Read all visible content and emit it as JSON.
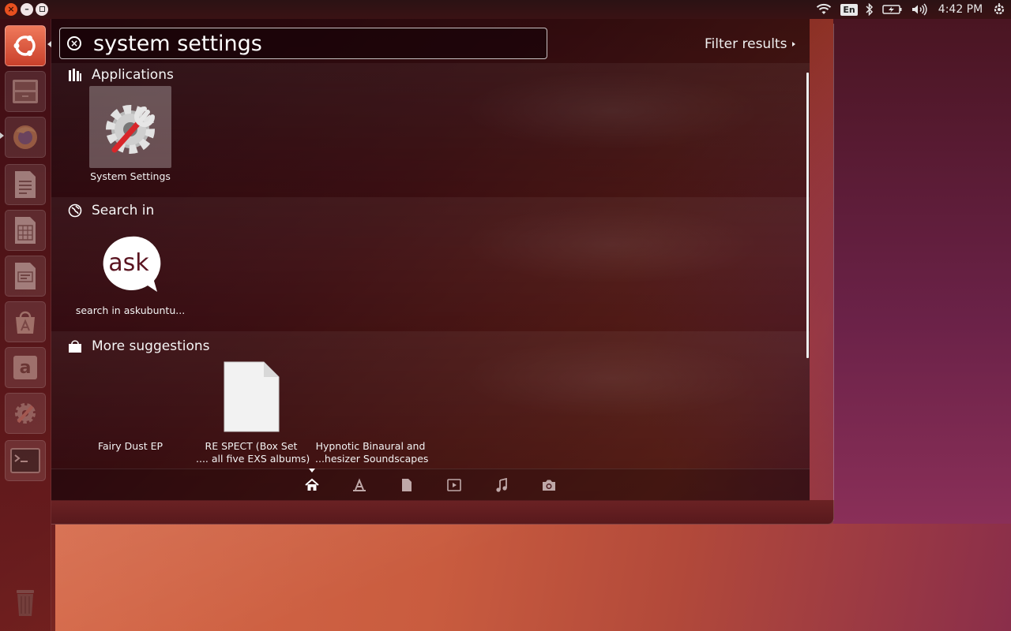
{
  "top_panel": {
    "keyboard_layout": "En",
    "clock": "4:42 PM"
  },
  "launcher": {
    "items": [
      {
        "name": "Dash home"
      },
      {
        "name": "Files"
      },
      {
        "name": "Firefox Web Browser"
      },
      {
        "name": "LibreOffice Writer"
      },
      {
        "name": "LibreOffice Calc"
      },
      {
        "name": "LibreOffice Impress"
      },
      {
        "name": "Ubuntu Software Center"
      },
      {
        "name": "Amazon"
      },
      {
        "name": "System Settings"
      },
      {
        "name": "Terminal"
      },
      {
        "name": "Trash"
      }
    ]
  },
  "search": {
    "query": "system settings"
  },
  "filter": {
    "label": "Filter results"
  },
  "sections": {
    "applications": {
      "title": "Applications",
      "items": [
        {
          "label": "System Settings"
        }
      ]
    },
    "search_in": {
      "title": "Search in",
      "items": [
        {
          "label": "search in askubuntu..."
        }
      ]
    },
    "more_suggestions": {
      "title": "More suggestions",
      "items": [
        {
          "label": "Fairy Dust EP"
        },
        {
          "label_line1": "RE SPECT (Box Set",
          "label_line2": ".... all five EXS albums)"
        },
        {
          "label_line1": "Hypnotic Binaural and",
          "label_line2": "...hesizer Soundscapes"
        }
      ]
    }
  },
  "lenses": [
    "home",
    "applications",
    "files",
    "video",
    "music",
    "photos"
  ],
  "colors": {
    "accent": "#dd4814",
    "launcher_active": "#e5603f"
  }
}
